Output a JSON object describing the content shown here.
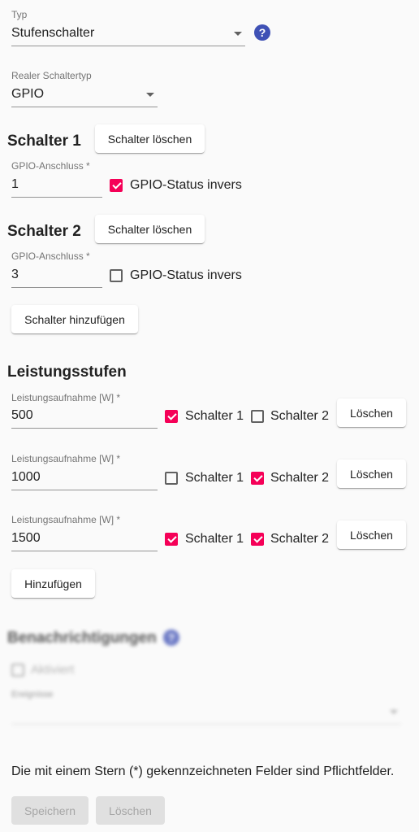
{
  "type_field": {
    "label": "Typ",
    "value": "Stufenschalter",
    "help": "?"
  },
  "real_switch_type": {
    "label": "Realer Schaltertyp",
    "value": "GPIO"
  },
  "switches": [
    {
      "title": "Schalter 1",
      "delete_label": "Schalter löschen",
      "gpio_label": "GPIO-Anschluss *",
      "gpio_value": "1",
      "invert_label": "GPIO-Status invers",
      "invert_checked": true
    },
    {
      "title": "Schalter 2",
      "delete_label": "Schalter löschen",
      "gpio_label": "GPIO-Anschluss *",
      "gpio_value": "3",
      "invert_label": "GPIO-Status invers",
      "invert_checked": false
    }
  ],
  "add_switch_label": "Schalter hinzufügen",
  "power_levels": {
    "title": "Leistungsstufen",
    "rows": [
      {
        "label": "Leistungsaufnahme [W] *",
        "value": "500",
        "s1_label": "Schalter 1",
        "s1": true,
        "s2_label": "Schalter 2",
        "s2": false,
        "delete_label": "Löschen"
      },
      {
        "label": "Leistungsaufnahme [W] *",
        "value": "1000",
        "s1_label": "Schalter 1",
        "s1": false,
        "s2_label": "Schalter 2",
        "s2": true,
        "delete_label": "Löschen"
      },
      {
        "label": "Leistungsaufnahme [W] *",
        "value": "1500",
        "s1_label": "Schalter 1",
        "s1": true,
        "s2_label": "Schalter 2",
        "s2": true,
        "delete_label": "Löschen"
      }
    ],
    "add_label": "Hinzufügen"
  },
  "notifications": {
    "title": "Benachrichtigungen",
    "help": "?",
    "enabled_label": "Aktiviert",
    "events_label": "Ereignisse"
  },
  "required_note": "Die mit einem Stern (*) gekennzeichneten Felder sind Pflichtfelder.",
  "actions": {
    "save_label": "Speichern",
    "delete_label": "Löschen"
  },
  "colors": {
    "accent": "#f50057",
    "help": "#3f51b5",
    "background": "#fafafa"
  }
}
